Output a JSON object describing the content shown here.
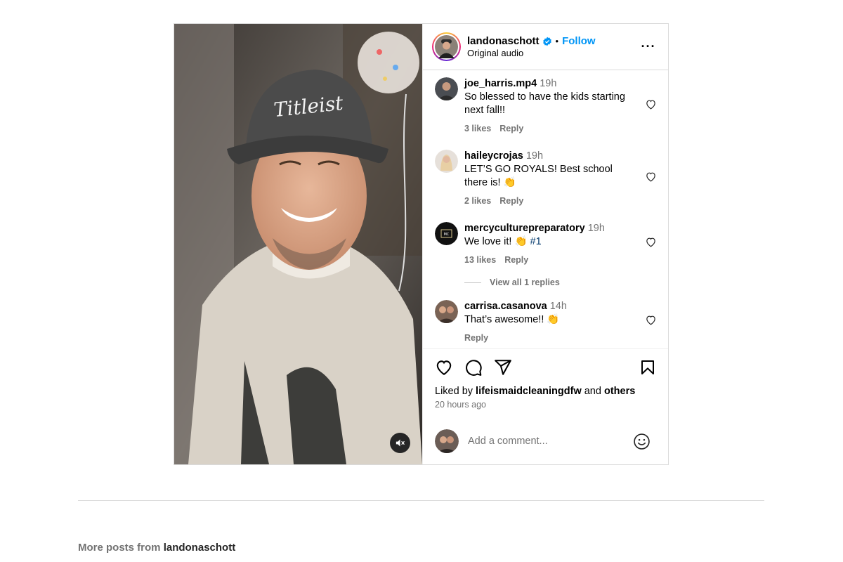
{
  "post": {
    "username": "landonaschott",
    "follow_label": "Follow",
    "separator": "•",
    "audio_label": "Original audio",
    "more_label": "···"
  },
  "comments": [
    {
      "user": "joe_harris.mp4",
      "time": "19h",
      "text": "So blessed to have the kids starting next fall!!",
      "likes": "3 likes",
      "reply": "Reply"
    },
    {
      "user": "haileycrojas",
      "time": "19h",
      "text": "LET’S GO ROYALS! Best school there is! 👏",
      "likes": "2 likes",
      "reply": "Reply"
    },
    {
      "user": "mercycultureprepa​ratory",
      "time": "19h",
      "text": "We love it! 👏",
      "hashtag": "#1",
      "likes": "13 likes",
      "reply": "Reply"
    },
    {
      "user": "carrisa.casanova",
      "time": "14h",
      "text": "That’s awesome!! 👏",
      "reply": "Reply"
    }
  ],
  "view_replies_label": "View all 1 replies",
  "liked_by": {
    "prefix": "Liked by ",
    "user": "lifeismaidcleaningdfw",
    "mid": " and ",
    "others": "others"
  },
  "time_ago": "20 hours ago",
  "comment_input": {
    "placeholder": "Add a comment..."
  },
  "footer": {
    "more_posts_prefix": "More posts from ",
    "more_posts_account": "landonaschott"
  },
  "icons": {
    "verified": "verified-badge-icon",
    "more": "more-options-icon",
    "heart": "heart-icon",
    "comment": "comment-icon",
    "share": "share-icon",
    "save": "bookmark-icon",
    "emoji": "emoji-icon",
    "mute": "muted-speaker-icon"
  },
  "colors": {
    "accent": "#0095f6",
    "secondary_text": "#737373",
    "border": "#dbdbdb",
    "hashtag": "#00376b"
  }
}
